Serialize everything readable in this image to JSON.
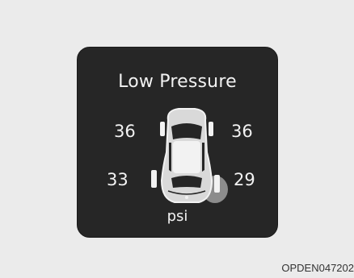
{
  "display": {
    "title": "Low Pressure",
    "unit": "psi",
    "tires": {
      "front_left": "36",
      "front_right": "36",
      "rear_left": "33",
      "rear_right": "29"
    },
    "low_tire": "rear_right",
    "colors": {
      "background": "#262626",
      "text": "#f2f2f2",
      "warning_highlight": "#8c8c8c"
    }
  },
  "figure_code": "OPDEN047202"
}
